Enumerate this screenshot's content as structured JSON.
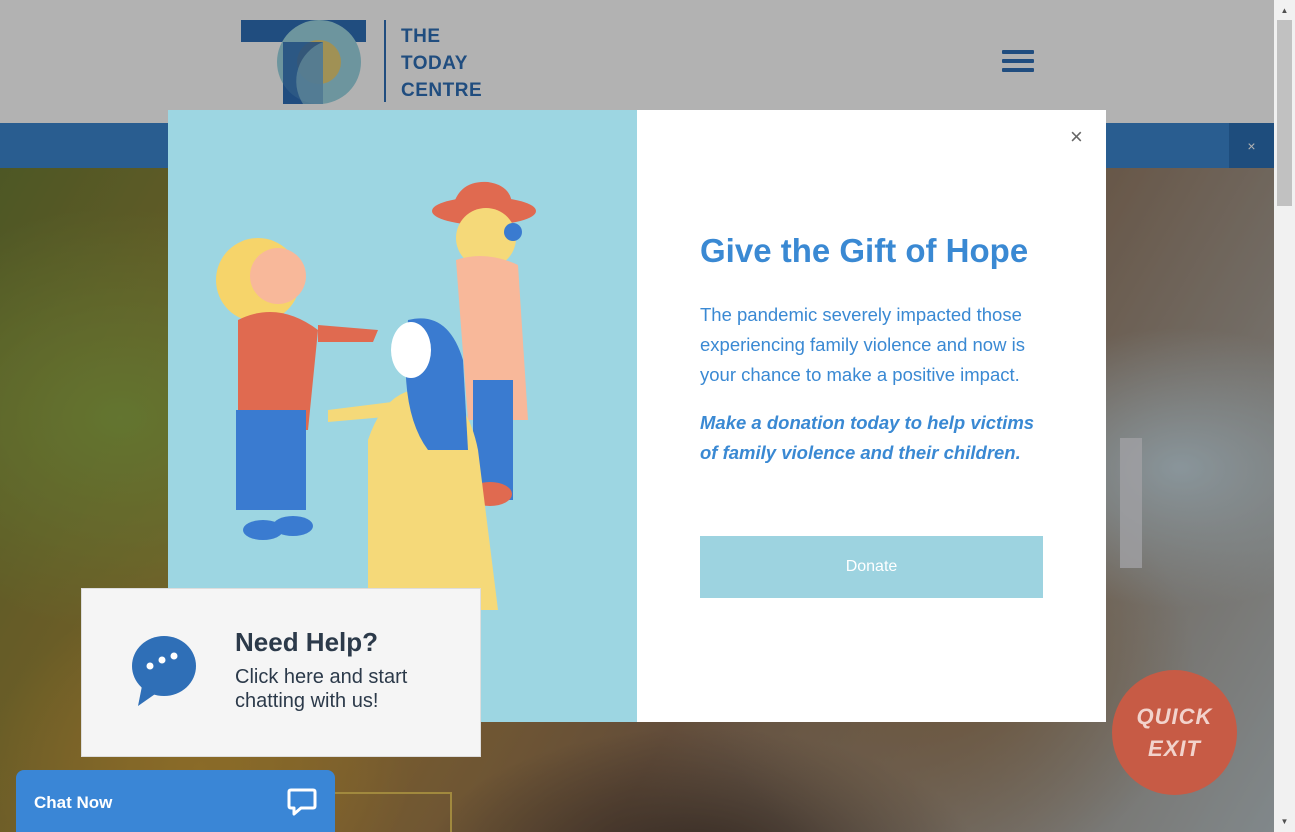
{
  "header": {
    "logo_text_line1": "THE",
    "logo_text_line2": "TODAY",
    "logo_text_line3": "CENTRE",
    "menu_icon": "hamburger-icon"
  },
  "banner": {
    "close_label": "×"
  },
  "modal": {
    "close_label": "×",
    "title": "Give the Gift of Hope",
    "body": "The pandemic severely impacted those experiencing family violence and now is your chance to make a positive impact.",
    "cta_text": "Make a donation today to help victims of family violence and their children.",
    "donate_label": "Donate",
    "illustration": "family-illustration"
  },
  "help_widget": {
    "icon": "chat-bubble-icon",
    "title": "Need Help?",
    "subtitle": "Click here and start chatting with us!"
  },
  "chat_bar": {
    "label": "Chat Now",
    "icon": "chat-icon"
  },
  "quick_exit": {
    "line1": "QUICK",
    "line2": "EXIT"
  },
  "scrollbar": {
    "up_arrow": "▲",
    "down_arrow": "▼"
  },
  "colors": {
    "brand_blue": "#2f6fb7",
    "modal_text": "#3a89d3",
    "donate_button": "#9dd3e0",
    "illustration_bg": "#9dd6e2",
    "quick_exit": "#c75b45"
  }
}
